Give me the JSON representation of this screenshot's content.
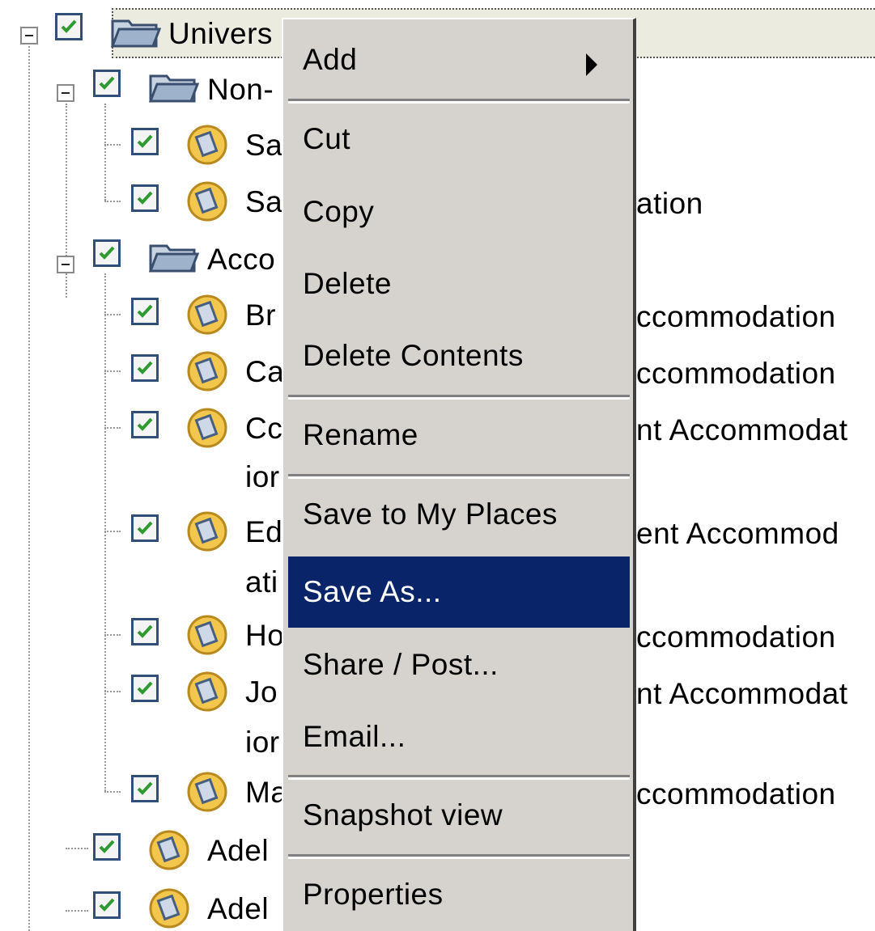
{
  "tree": {
    "root": {
      "label": "Univers",
      "checked": true
    },
    "rows": [
      {
        "label": "Non-",
        "type": "folder"
      },
      {
        "label": "Sa",
        "type": "item"
      },
      {
        "label": "Sa",
        "tail": "ation",
        "type": "item"
      },
      {
        "label": "Acco",
        "type": "folder"
      },
      {
        "label": "Br",
        "tail": "ccommodation",
        "type": "item"
      },
      {
        "label": "Ca",
        "tail": "ccommodation",
        "type": "item"
      },
      {
        "label": "Cc",
        "tail": "nt Accommodat",
        "wrap": "ior",
        "type": "item"
      },
      {
        "label": "Ed",
        "tail": "ent Accommod",
        "wrap": "ati",
        "type": "item"
      },
      {
        "label": "Ho",
        "tail": "ccommodation",
        "type": "item"
      },
      {
        "label": "Jo",
        "tail": "nt Accommodat",
        "wrap": "ior",
        "type": "item"
      },
      {
        "label": "Ma",
        "tail": "ccommodation",
        "type": "item"
      },
      {
        "label": "Adel",
        "type": "item"
      },
      {
        "label": "Adel",
        "type": "item"
      }
    ]
  },
  "context_menu": {
    "items": [
      {
        "label": "Add",
        "submenu": true
      },
      {
        "label": "Cut"
      },
      {
        "label": "Copy"
      },
      {
        "label": "Delete"
      },
      {
        "label": "Delete Contents"
      },
      {
        "label": "Rename"
      },
      {
        "label": "Save to My Places"
      },
      {
        "label": "Save As...",
        "highlighted": true
      },
      {
        "label": "Share / Post..."
      },
      {
        "label": "Email..."
      },
      {
        "label": "Snapshot view"
      },
      {
        "label": "Properties"
      }
    ]
  },
  "colors": {
    "highlight": "#0a246a",
    "menu_bg": "#d6d3ce",
    "selected_row_bg": "#ecebdf"
  }
}
